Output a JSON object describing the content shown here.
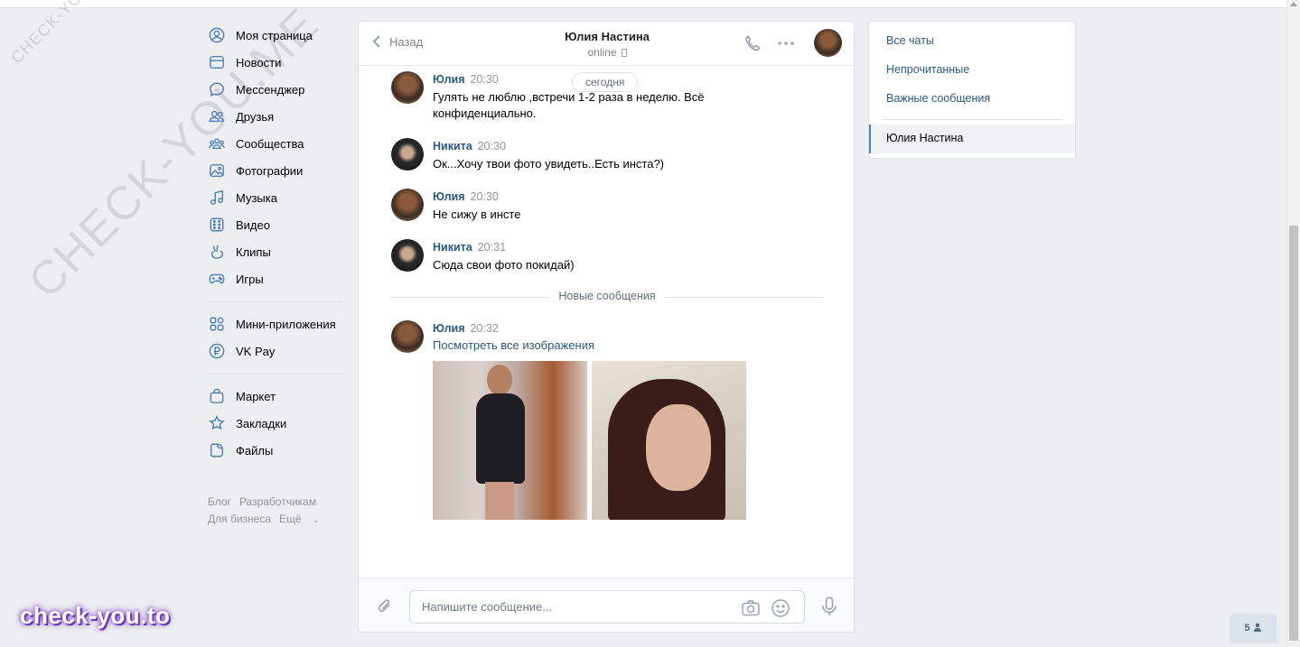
{
  "watermarks": {
    "small": "CHECK-YOU.ME",
    "big": "CHECK-YOU.ME",
    "brand": "check-you.to"
  },
  "leftnav": {
    "items": [
      {
        "label": "Моя страница",
        "icon": "user-circle-icon"
      },
      {
        "label": "Новости",
        "icon": "newspaper-icon"
      },
      {
        "label": "Мессенджер",
        "icon": "chat-bubble-icon"
      },
      {
        "label": "Друзья",
        "icon": "friends-icon"
      },
      {
        "label": "Сообщества",
        "icon": "communities-icon"
      },
      {
        "label": "Фотографии",
        "icon": "photo-icon"
      },
      {
        "label": "Музыка",
        "icon": "music-note-icon"
      },
      {
        "label": "Видео",
        "icon": "video-icon"
      },
      {
        "label": "Клипы",
        "icon": "clips-icon"
      },
      {
        "label": "Игры",
        "icon": "gamepad-icon"
      }
    ],
    "items2": [
      {
        "label": "Мини-приложения",
        "icon": "apps-grid-icon"
      },
      {
        "label": "VK Pay",
        "icon": "ruble-icon"
      }
    ],
    "items3": [
      {
        "label": "Маркет",
        "icon": "bag-icon"
      },
      {
        "label": "Закладки",
        "icon": "star-icon"
      },
      {
        "label": "Файлы",
        "icon": "file-icon"
      }
    ],
    "footer": {
      "blog": "Блог",
      "dev": "Разработчикам",
      "business": "Для бизнеса",
      "more": "Ещё"
    }
  },
  "chat": {
    "back_label": "Назад",
    "peer_name": "Юлия Настина",
    "peer_status": "online",
    "day_label": "сегодня",
    "messages": [
      {
        "author": "Юлия",
        "time": "20:30",
        "text": "Гулять не люблю ,встречи 1-2 раза в неделю. Всё конфиденциально."
      },
      {
        "author": "Никита",
        "time": "20:30",
        "text": "Ок...Хочу твои фото увидеть..Есть инста?)"
      },
      {
        "author": "Юлия",
        "time": "20:30",
        "text": "Не сижу в инсте"
      },
      {
        "author": "Никита",
        "time": "20:31",
        "text": "Сюда свои фото покидай)"
      },
      {
        "author": "Юлия",
        "time": "20:32",
        "text": "Посмотреть все изображения"
      }
    ],
    "new_messages_label": "Новые сообщения",
    "composer_placeholder": "Напишите сообщение..."
  },
  "rightnav": {
    "all_chats": "Все чаты",
    "unread": "Непрочитанные",
    "important": "Важные сообщения",
    "active_chat": "Юлия Настина"
  },
  "online_count": "5",
  "colors": {
    "accent": "#5181b8",
    "link": "#2a5885",
    "background": "#edeef0"
  }
}
